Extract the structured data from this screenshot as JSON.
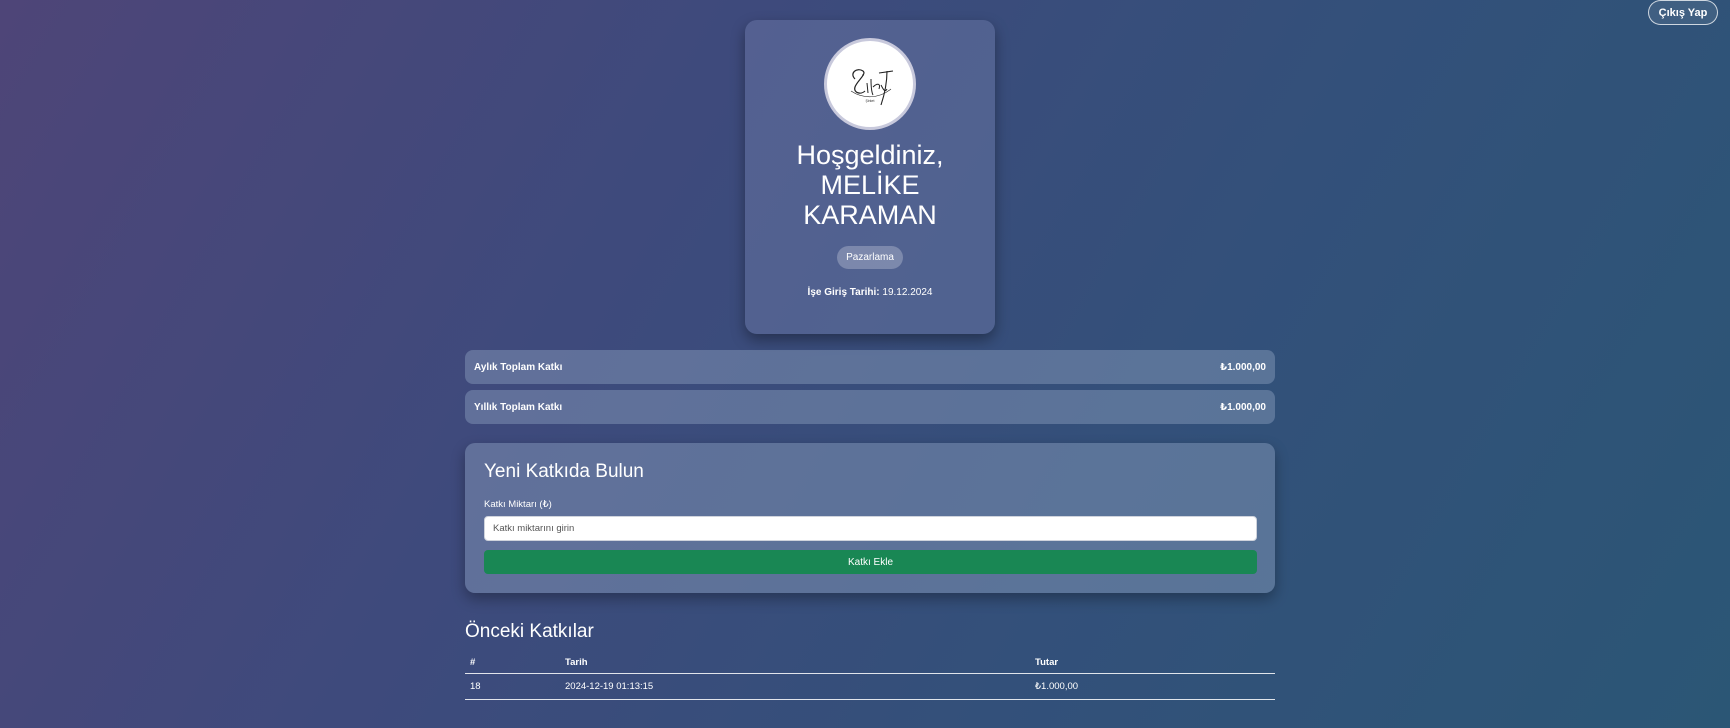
{
  "header": {
    "logout_label": "Çıkış Yap"
  },
  "profile": {
    "logo_text": "Şirket",
    "welcome_line1": "Hoşgeldiniz,",
    "name_line1": "MELİKE",
    "name_line2": "KARAMAN",
    "department": "Pazarlama",
    "start_date_label": "İşe Giriş Tarihi:",
    "start_date_value": "19.12.2024"
  },
  "summary": {
    "monthly_label": "Aylık Toplam Katkı",
    "monthly_value": "₺1.000,00",
    "yearly_label": "Yıllık Toplam Katkı",
    "yearly_value": "₺1.000,00"
  },
  "form": {
    "title": "Yeni Katkıda Bulun",
    "amount_label": "Katkı Miktarı (₺)",
    "amount_placeholder": "Katkı miktarını girin",
    "submit_label": "Katkı Ekle"
  },
  "history": {
    "title": "Önceki Katkılar",
    "columns": [
      "#",
      "Tarih",
      "Tutar"
    ],
    "rows": [
      {
        "id": "18",
        "date": "2024-12-19 01:13:15",
        "amount": "₺1.000,00"
      }
    ]
  },
  "colors": {
    "submit_button": "#198754",
    "card_background": "#6e7daa"
  }
}
